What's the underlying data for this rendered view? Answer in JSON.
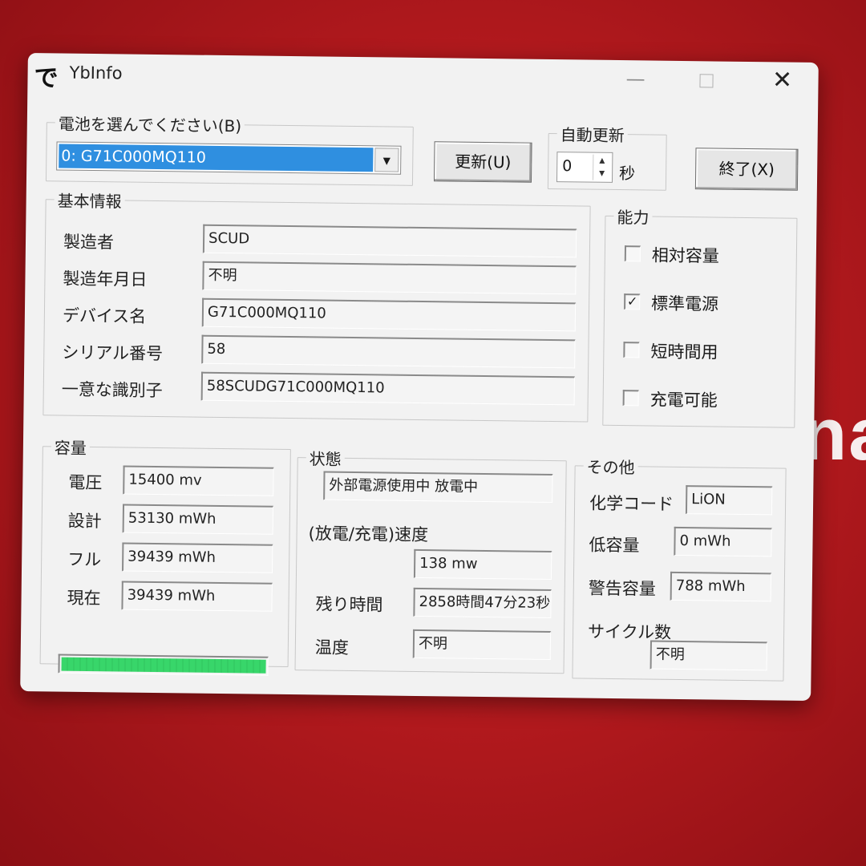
{
  "window": {
    "title": "YbInfo",
    "icon_glyph": "で",
    "minimize_glyph": "—",
    "close_glyph": "✕"
  },
  "battery_select": {
    "legend": "電池を選んでください(B)",
    "value": "0: G71C000MQ110",
    "arrow_glyph": "▼"
  },
  "buttons": {
    "refresh": "更新(U)",
    "exit": "終了(X)"
  },
  "auto_refresh": {
    "legend": "自動更新",
    "value": "0",
    "unit": "秒",
    "up_glyph": "▲",
    "down_glyph": "▼"
  },
  "basic_info": {
    "legend": "基本情報",
    "rows": [
      {
        "label": "製造者",
        "value": "SCUD"
      },
      {
        "label": "製造年月日",
        "value": "不明"
      },
      {
        "label": "デバイス名",
        "value": "G71C000MQ110"
      },
      {
        "label": "シリアル番号",
        "value": "58"
      },
      {
        "label": "一意な識別子",
        "value": "58SCUDG71C000MQ110"
      }
    ]
  },
  "capability": {
    "legend": "能力",
    "items": [
      {
        "label": "相対容量",
        "checked": false,
        "mark": ""
      },
      {
        "label": "標準電源",
        "checked": true,
        "mark": "✓"
      },
      {
        "label": "短時間用",
        "checked": false,
        "mark": ""
      },
      {
        "label": "充電可能",
        "checked": false,
        "mark": ""
      }
    ]
  },
  "capacity": {
    "legend": "容量",
    "rows": [
      {
        "label": "電圧",
        "value": "15400 mv"
      },
      {
        "label": "設計",
        "value": "53130 mWh"
      },
      {
        "label": "フル",
        "value": "39439 mWh"
      },
      {
        "label": "現在",
        "value": "39439 mWh"
      }
    ],
    "charge_fraction": 1.0,
    "bar_color": "#38d66a"
  },
  "status": {
    "legend": "状態",
    "state_value": "外部電源使用中 放電中",
    "rate_label": "(放電/充電)速度",
    "rate_value": "138 mw",
    "remaining_label": "残り時間",
    "remaining_value": "2858時間47分23秒",
    "temperature_label": "温度",
    "temperature_value": "不明"
  },
  "other": {
    "legend": "その他",
    "chem_label": "化学コード",
    "chem_value": "LiON",
    "low_label": "低容量",
    "low_value": "0 mWh",
    "warn_label": "警告容量",
    "warn_value": "788 mWh",
    "cycle_label": "サイクル数",
    "cycle_value": "不明"
  },
  "background": {
    "text": "na"
  }
}
